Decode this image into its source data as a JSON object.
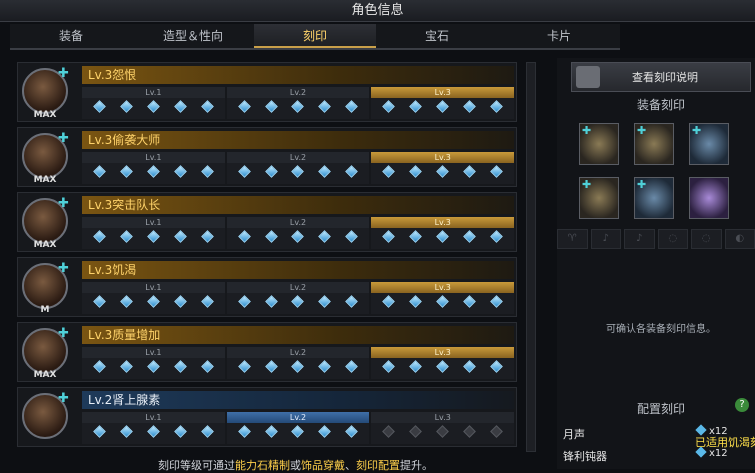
{
  "window": {
    "title": "角色信息"
  },
  "tabs": [
    {
      "label": "装备"
    },
    {
      "label": "造型＆性向"
    },
    {
      "label": "刻印"
    },
    {
      "label": "宝石"
    },
    {
      "label": "卡片"
    }
  ],
  "active_tab": 2,
  "engravings": [
    {
      "name": "Lv.3怨恨",
      "badge": "MAX",
      "level": 3,
      "levels": [
        "Lv.1",
        "Lv.2",
        "Lv.3"
      ]
    },
    {
      "name": "Lv.3偷袭大师",
      "badge": "MAX",
      "level": 3,
      "levels": [
        "Lv.1",
        "Lv.2",
        "Lv.3"
      ]
    },
    {
      "name": "Lv.3突击队长",
      "badge": "MAX",
      "level": 3,
      "levels": [
        "Lv.1",
        "Lv.2",
        "Lv.3"
      ]
    },
    {
      "name": "Lv.3饥渴",
      "badge": "M",
      "level": 3,
      "levels": [
        "Lv.1",
        "Lv.2",
        "Lv.3"
      ]
    },
    {
      "name": "Lv.3质量增加",
      "badge": "MAX",
      "level": 3,
      "levels": [
        "Lv.1",
        "Lv.2",
        "Lv.3"
      ]
    },
    {
      "name": "Lv.2肾上腺素",
      "badge": "",
      "level": 2,
      "levels": [
        "Lv.1",
        "Lv.2",
        "Lv.3"
      ]
    }
  ],
  "right": {
    "desc_button": "查看刻印说明",
    "equip_title": "装备刻印",
    "slot_marks": [
      "",
      "I",
      "II",
      "I",
      "II",
      ""
    ],
    "info_text": "可确认各装备刻印信息。",
    "config_title": "配置刻印",
    "help": "?",
    "configs": [
      {
        "name": "月声",
        "count": "x12"
      },
      {
        "name": "锋利钝器",
        "count": "x12"
      }
    ],
    "applied_text": "已适用饥渴刻"
  },
  "footer": {
    "prefix": "刻印等级可通过",
    "hl1": "能力石精制",
    "mid1": "或",
    "hl2": "饰品穿戴",
    "mid2": "、",
    "hl3": "刻印配置",
    "suffix": "提升。"
  },
  "colors": {
    "gold": "#ffd36a",
    "gem": "#5ab8e8",
    "accent": "#c9a04a"
  }
}
